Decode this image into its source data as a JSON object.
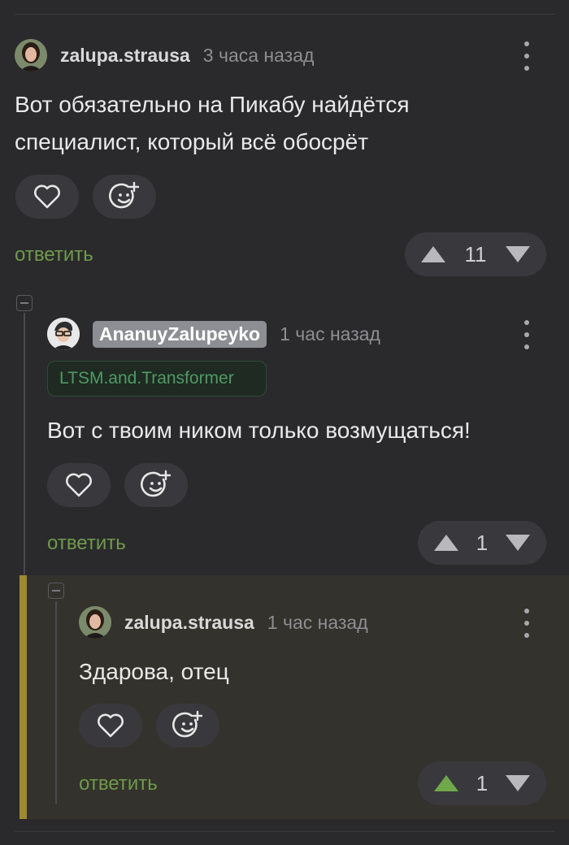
{
  "comments": [
    {
      "username": "zalupa.strausa",
      "time": "3 часа назад",
      "text_line1": "Вот обязательно на Пикабу найдётся",
      "text_line2": "специалист, который всё обосрёт",
      "reply_label": "ответить",
      "vote_count": "11",
      "icons": [
        "heart-icon",
        "emoji-add-icon",
        "arrow-up-icon",
        "arrow-down-icon",
        "more-vertical-icon"
      ]
    },
    {
      "username": "AnanuyZalupeyko",
      "time": "1 час назад",
      "tag": "LTSM.and.Transformer",
      "text": "Вот с твоим ником только возмущаться!",
      "reply_label": "ответить",
      "vote_count": "1"
    },
    {
      "username": "zalupa.strausa",
      "time": "1 час назад",
      "text": "Здарова, отец",
      "reply_label": "ответить",
      "vote_count": "1",
      "upvoted": true
    }
  ],
  "colors": {
    "background": "#2a2a2d",
    "reply_green": "#6f9a4a",
    "upvote_active": "#6fa84a",
    "highlight_bar": "#9d8a2e",
    "badge_gray": "#8d8e93",
    "tag_green": "#4f9a62"
  }
}
